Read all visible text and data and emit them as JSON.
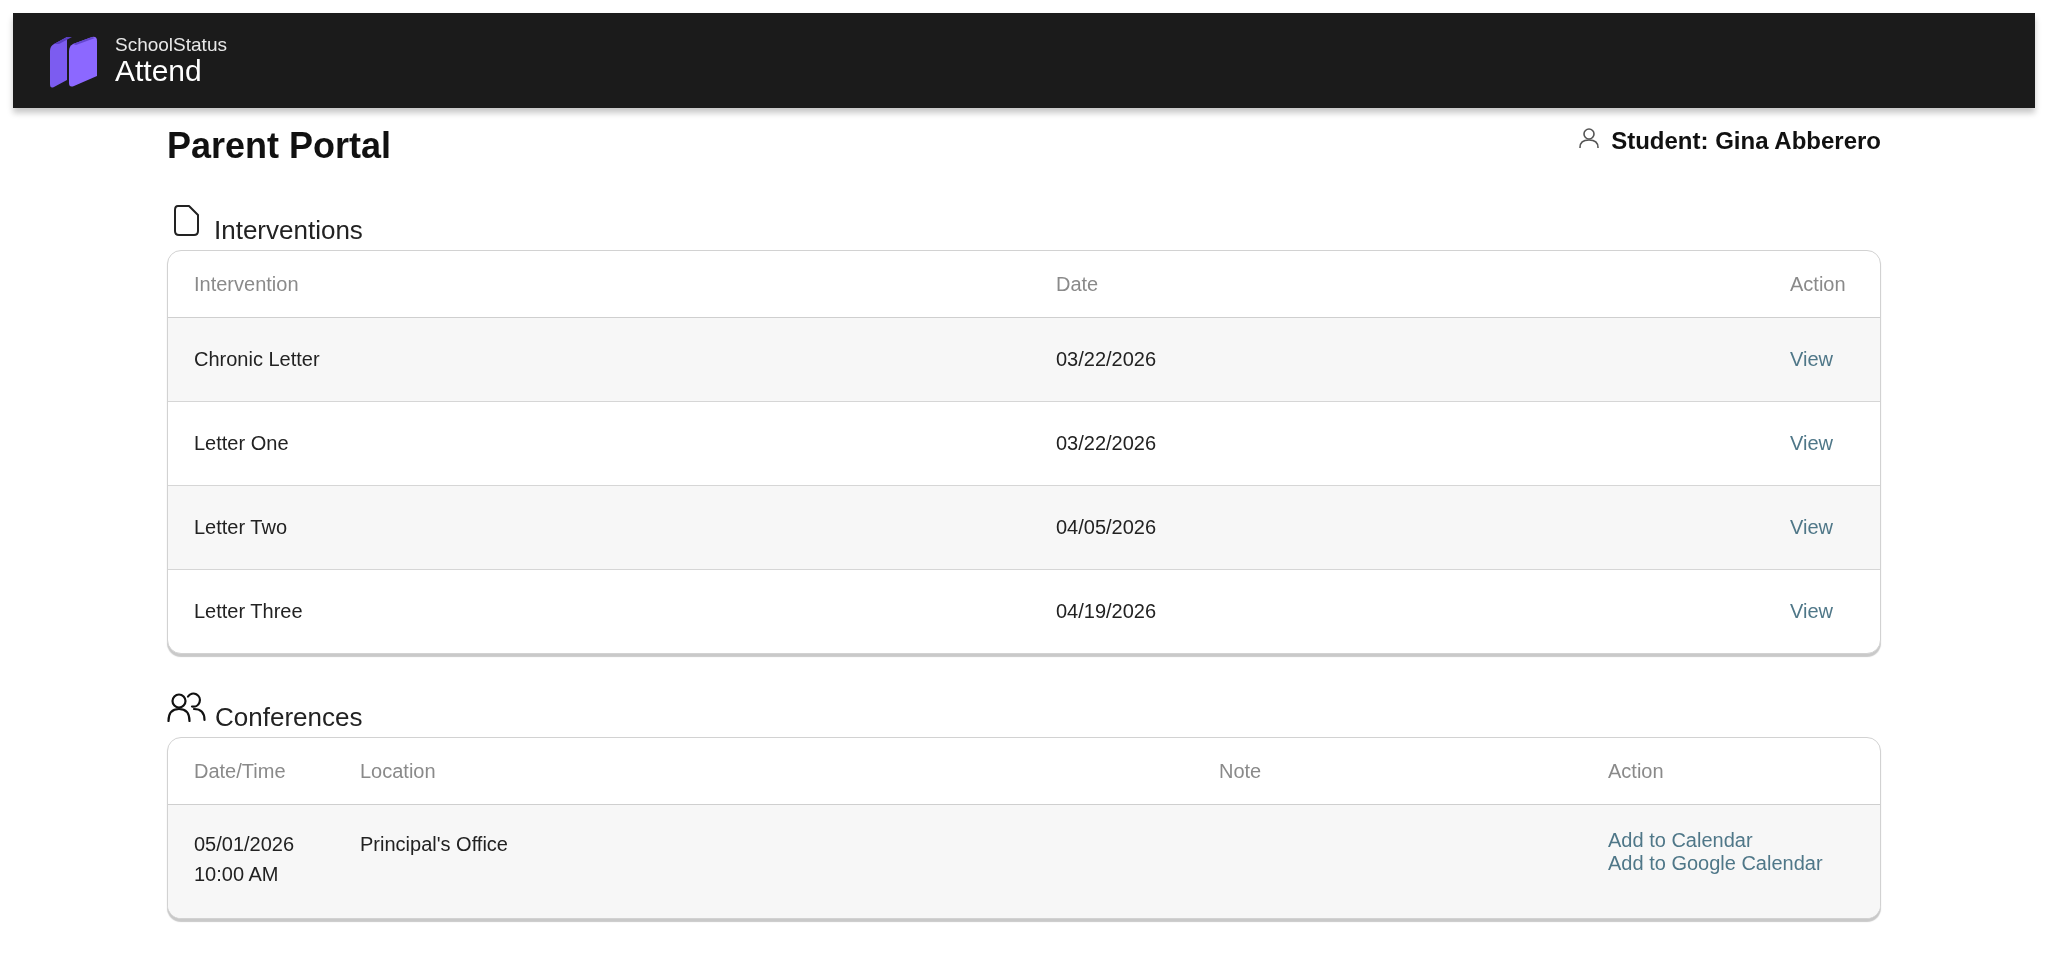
{
  "header": {
    "brand": "SchoolStatus",
    "product": "Attend"
  },
  "page": {
    "title": "Parent Portal",
    "student": "Student: Gina Abberero"
  },
  "interventions": {
    "title": "Interventions",
    "columns": [
      "Intervention",
      "Date",
      "Action"
    ],
    "rows": [
      {
        "intervention": "Chronic Letter",
        "date": "03/22/2026",
        "action": "View"
      },
      {
        "intervention": "Letter One",
        "date": "03/22/2026",
        "action": "View"
      },
      {
        "intervention": "Letter Two",
        "date": "04/05/2026",
        "action": "View"
      },
      {
        "intervention": "Letter Three",
        "date": "04/19/2026",
        "action": "View"
      }
    ]
  },
  "conferences": {
    "title": "Conferences",
    "columns": [
      "Date/Time",
      "Location",
      "Note",
      "Action"
    ],
    "rows": [
      {
        "date": "05/01/2026",
        "time": "10:00 AM",
        "location": "Principal's Office",
        "actions": [
          "Add to Calendar",
          "Add to Google Calendar"
        ]
      }
    ]
  }
}
